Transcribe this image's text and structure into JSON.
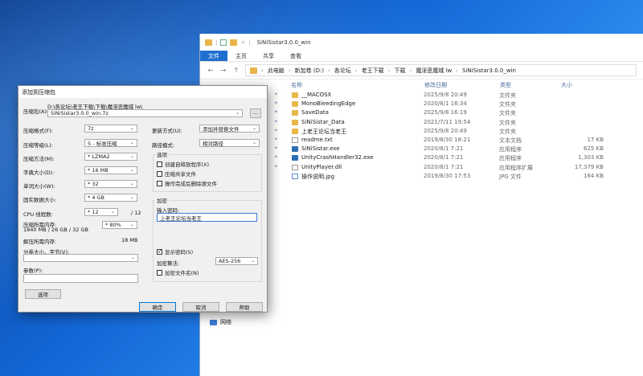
{
  "explorer": {
    "title": "SiNiSistar3.0.0_win",
    "ribbon_tabs": [
      "文件",
      "主页",
      "共享",
      "查看"
    ],
    "nav_back": "←",
    "nav_forward": "→",
    "nav_up": "↑",
    "breadcrumbs": [
      "此电脑",
      "新加卷 (D:)",
      "各论坛",
      "老王下载",
      "下载",
      "魔淫恶魔城 lw",
      "SiNiSistar3.0.0_win"
    ],
    "columns": {
      "name": "名称",
      "date": "修改日期",
      "type": "类型",
      "size": "大小"
    },
    "files": [
      {
        "name": "__MACOSX",
        "date": "2025/9/8 20:49",
        "type": "文件夹",
        "size": "",
        "icon": "folder-icon"
      },
      {
        "name": "MonoBleedingEdge",
        "date": "2020/8/1 16:34",
        "type": "文件夹",
        "size": "",
        "icon": "folder-icon"
      },
      {
        "name": "SaveData",
        "date": "2025/9/8 16:19",
        "type": "文件夹",
        "size": "",
        "icon": "folder-icon"
      },
      {
        "name": "SiNiSistar_Data",
        "date": "2021/7/11 19:54",
        "type": "文件夹",
        "size": "",
        "icon": "folder-icon"
      },
      {
        "name": "上老王论坛当老王",
        "date": "2025/9/8 20:49",
        "type": "文件夹",
        "size": "",
        "icon": "folder-icon"
      },
      {
        "name": "readme.txt",
        "date": "2019/8/30 18:21",
        "type": "文本文档",
        "size": "17 KB",
        "icon": "text-file-icon"
      },
      {
        "name": "SiNiSistar.exe",
        "date": "2020/8/1 7:21",
        "type": "应用程序",
        "size": "625 KB",
        "icon": "exe-icon"
      },
      {
        "name": "UnityCrashHandler32.exe",
        "date": "2020/8/1 7:21",
        "type": "应用程序",
        "size": "1,303 KB",
        "icon": "exe-icon"
      },
      {
        "name": "UnityPlayer.dll",
        "date": "2020/8/1 7:21",
        "type": "应用程序扩展",
        "size": "17,379 KB",
        "icon": "dll-icon"
      },
      {
        "name": "操作说明.jpg",
        "date": "2019/8/30 17:53",
        "type": "JPG 文件",
        "size": "164 KB",
        "icon": "image-icon"
      }
    ],
    "network_label": "网络"
  },
  "dialog": {
    "title": "添加到压缩包",
    "archive_name_label": "压缩包(A):",
    "archive_path": "D:\\各论坛\\老王下载\\下载\\魔淫恶魔城 lw\\",
    "archive_name": "SiNiSistar3.0.0_win.7z",
    "browse_label": "...",
    "format_label": "压缩格式(F):",
    "format_value": "7z",
    "level_label": "压缩等级(L):",
    "level_value": "5 - 标准压缩",
    "method_label": "压缩方法(M):",
    "method_value": "* LZMA2",
    "dict_label": "字典大小(D):",
    "dict_value": "* 16 MB",
    "word_label": "单词大小(W):",
    "word_value": "* 32",
    "solid_label": "固实数据大小:",
    "solid_value": "* 4 GB",
    "threads_label": "CPU 线程数:",
    "threads_value": "* 12",
    "threads_max": "/ 12",
    "mem_comp_label": "压缩所需内存:",
    "mem_comp_value": "1840 MB / 26 GB / 32 GB",
    "mem_pct": "* 80%",
    "mem_decomp_label": "解压所需内存:",
    "mem_decomp_value": "18 MB",
    "split_label": "分卷大小，字节(V):",
    "params_label": "参数(P):",
    "options_button": "选项",
    "update_label": "更新方式(U):",
    "update_value": "添加并替换文件",
    "pathmode_label": "路径模式:",
    "pathmode_value": "相对路径",
    "options_group": "选项",
    "opt_sfx": "创建自释放程序(X)",
    "opt_shared": "压缩共享文件",
    "opt_delete": "操作完成后删除源文件",
    "encrypt_group": "加密",
    "password_label": "输入密码:",
    "password_value": "上老王论坛当老王",
    "show_password": "显示密码(S)",
    "encrypt_method_label": "加密算法:",
    "encrypt_method_value": "AES-256",
    "encrypt_names": "加密文件名(N)",
    "ok_button": "确定",
    "cancel_button": "取消",
    "help_button": "帮助"
  }
}
